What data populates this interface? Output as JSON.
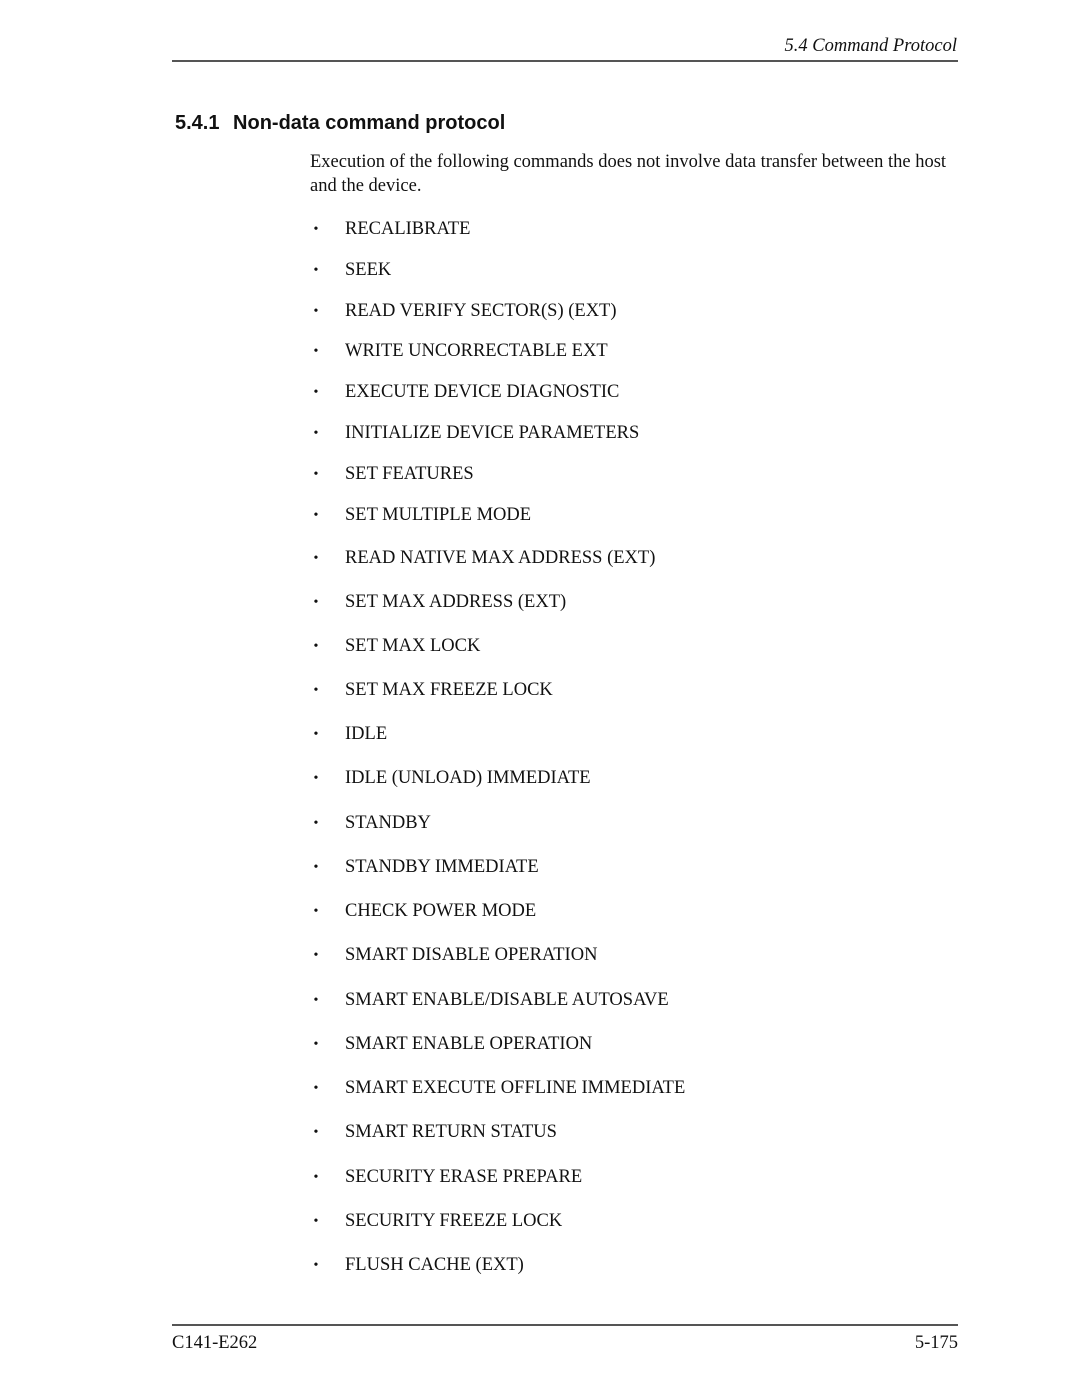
{
  "header": {
    "running_title": "5.4  Command Protocol"
  },
  "section": {
    "number": "5.4.1",
    "title": "Non-data command protocol",
    "intro": "Execution of the following commands does not involve data transfer between the host and the device."
  },
  "bullet_glyph": "•",
  "commands": [
    "RECALIBRATE",
    "SEEK",
    "READ VERIFY SECTOR(S) (EXT)",
    "WRITE UNCORRECTABLE EXT",
    "EXECUTE DEVICE DIAGNOSTIC",
    "INITIALIZE DEVICE PARAMETERS",
    "SET FEATURES",
    "SET MULTIPLE MODE",
    "READ NATIVE MAX ADDRESS (EXT)",
    "SET MAX ADDRESS (EXT)",
    "SET MAX LOCK",
    "SET MAX FREEZE LOCK",
    "IDLE",
    "IDLE (UNLOAD) IMMEDIATE",
    "STANDBY",
    "STANDBY IMMEDIATE",
    "CHECK POWER MODE",
    "SMART DISABLE OPERATION",
    "SMART ENABLE/DISABLE AUTOSAVE",
    "SMART ENABLE OPERATION",
    "SMART EXECUTE OFFLINE IMMEDIATE",
    "SMART RETURN STATUS",
    "SECURITY ERASE PREPARE",
    "SECURITY FREEZE LOCK",
    "FLUSH CACHE (EXT)"
  ],
  "footer": {
    "document_id": "C141-E262",
    "page_number": "5-175"
  }
}
